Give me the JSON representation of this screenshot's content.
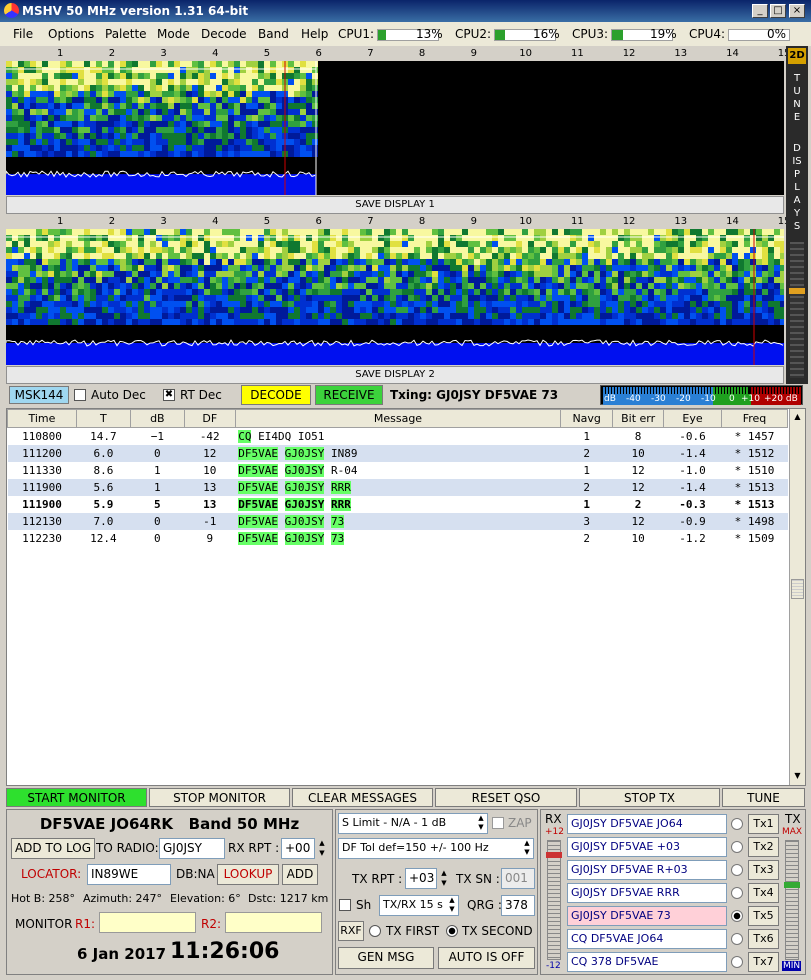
{
  "window": {
    "title": "MSHV 50 MHz version 1.31 64-bit",
    "min": "_",
    "max": "□",
    "close": "×"
  },
  "menu": [
    "File",
    "Options",
    "Palette",
    "Mode",
    "Decode",
    "Band",
    "Help"
  ],
  "cpu": [
    {
      "label": "CPU1:",
      "pct": "13%",
      "fill": 0.13
    },
    {
      "label": "CPU2:",
      "pct": "16%",
      "fill": 0.16
    },
    {
      "label": "CPU3:",
      "pct": "19%",
      "fill": 0.19
    },
    {
      "label": "CPU4:",
      "pct": "0%",
      "fill": 0
    }
  ],
  "ticks": [
    "1",
    "2",
    "3",
    "4",
    "5",
    "6",
    "7",
    "8",
    "9",
    "10",
    "11",
    "12",
    "13",
    "14",
    "15"
  ],
  "save1": "SAVE DISPLAY 1",
  "save2": "SAVE DISPLAY 2",
  "side": {
    "mode2d": "2D",
    "tune": "TUNE",
    "display": "DISPLAYS"
  },
  "status": {
    "mode": "MSK144",
    "autodec": "Auto Dec",
    "rtdec": "RT Dec",
    "decode": "DECODE",
    "receive": "RECEIVE",
    "txing": "Txing: GJ0JSY DF5VAE 73"
  },
  "meter": {
    "scale": [
      "dB",
      "-40",
      "-30",
      "-20",
      "-10",
      "0",
      "+10",
      "+20 dB"
    ]
  },
  "columns": [
    "Time",
    "T",
    "dB",
    "DF",
    "Message",
    "Navg",
    "Bit err",
    "Eye",
    "Freq"
  ],
  "rows": [
    {
      "time": "110800",
      "t": "14.7",
      "db": "−1",
      "df": "-42",
      "msg": [
        "CQ",
        "EI4DQ",
        "IO51"
      ],
      "hlc": [
        1,
        0,
        0
      ],
      "navg": "1",
      "bit": "8",
      "eye": "-0.6",
      "freq": "* 1457",
      "bold": false,
      "bg": "#ffffff"
    },
    {
      "time": "111200",
      "t": "6.0",
      "db": "0",
      "df": "12",
      "msg": [
        "DF5VAE",
        "GJ0JSY",
        "IN89"
      ],
      "hlc": [
        1,
        1,
        0
      ],
      "navg": "2",
      "bit": "10",
      "eye": "-1.4",
      "freq": "* 1512",
      "bold": false,
      "bg": "#d6e0f0"
    },
    {
      "time": "111330",
      "t": "8.6",
      "db": "1",
      "df": "10",
      "msg": [
        "DF5VAE",
        "GJ0JSY",
        "R-04"
      ],
      "hlc": [
        1,
        1,
        0
      ],
      "navg": "1",
      "bit": "12",
      "eye": "-1.0",
      "freq": "* 1510",
      "bold": false,
      "bg": "#ffffff"
    },
    {
      "time": "111900",
      "t": "5.6",
      "db": "1",
      "df": "13",
      "msg": [
        "DF5VAE",
        "GJ0JSY",
        "RRR"
      ],
      "hlc": [
        1,
        1,
        1
      ],
      "navg": "2",
      "bit": "12",
      "eye": "-1.4",
      "freq": "* 1513",
      "bold": false,
      "bg": "#d6e0f0"
    },
    {
      "time": "111900",
      "t": "5.9",
      "db": "5",
      "df": "13",
      "msg": [
        "DF5VAE",
        "GJ0JSY",
        "RRR"
      ],
      "hlc": [
        1,
        1,
        1
      ],
      "navg": "1",
      "bit": "2",
      "eye": "-0.3",
      "freq": "* 1513",
      "bold": true,
      "bg": "#ffffff"
    },
    {
      "time": "112130",
      "t": "7.0",
      "db": "0",
      "df": "-1",
      "msg": [
        "DF5VAE",
        "GJ0JSY",
        "73"
      ],
      "hlc": [
        1,
        1,
        1
      ],
      "navg": "3",
      "bit": "12",
      "eye": "-0.9",
      "freq": "* 1498",
      "bold": false,
      "bg": "#d6e0f0"
    },
    {
      "time": "112230",
      "t": "12.4",
      "db": "0",
      "df": "9",
      "msg": [
        "DF5VAE",
        "GJ0JSY",
        "73"
      ],
      "hlc": [
        1,
        1,
        1
      ],
      "navg": "2",
      "bit": "10",
      "eye": "-1.2",
      "freq": "* 1509",
      "bold": false,
      "bg": "#ffffff"
    }
  ],
  "buttons": {
    "start": "START MONITOR",
    "stop": "STOP MONITOR",
    "clear": "CLEAR MESSAGES",
    "reset": "RESET QSO",
    "stoptx": "STOP TX",
    "tune": "TUNE"
  },
  "station": {
    "title": "DF5VAE JO64RK",
    "band": "Band 50 MHz",
    "addlog": "ADD TO LOG",
    "toradio": "TO RADIO:",
    "callsign": "GJ0JSY",
    "rxrpt": "RX RPT :",
    "rxrptval": "+00",
    "locator": "LOCATOR:",
    "locval": "IN89WE",
    "db": "DB:NA",
    "lookup": "LOOKUP",
    "add": "ADD",
    "hotb": "Hot B: 258°",
    "azimuth": "Azimuth: 247°",
    "elevation": "Elevation: 6°",
    "dstc": "Dstc: 1217 km",
    "monitor": "MONITOR",
    "r1": "R1:",
    "r2": "R2:",
    "date": "6 Jan 2017",
    "time": "11:26:06"
  },
  "mid": {
    "slimit": "S Limit - N/A - 1  dB",
    "zap": "ZAP",
    "dftol": "DF Tol def=150 +/-  100  Hz",
    "txrpt": "TX RPT :",
    "txrptval": "+03",
    "txsn": "TX SN :",
    "txsnval": "001",
    "sh": "Sh",
    "txrx": "TX/RX 15 s",
    "qrg": "QRG :",
    "qrgval": "378",
    "rxf": "RXF",
    "txfirst": "TX FIRST",
    "txsecond": "TX SECOND",
    "genmsg": "GEN MSG",
    "autoisoff": "AUTO IS OFF"
  },
  "tx": {
    "rxlabel": "RX",
    "rxtop": "+12",
    "rxbot": "-12",
    "txlabel": "TX",
    "max": "MAX",
    "min": "MIN",
    "msgs": [
      "GJ0JSY DF5VAE JO64",
      "GJ0JSY DF5VAE +03",
      "GJ0JSY DF5VAE R+03",
      "GJ0JSY DF5VAE RRR",
      "GJ0JSY DF5VAE 73",
      "CQ DF5VAE JO64",
      "CQ 378 DF5VAE"
    ],
    "btns": [
      "Tx1",
      "Tx2",
      "Tx3",
      "Tx4",
      "Tx5",
      "Tx6",
      "Tx7"
    ],
    "active": 4
  }
}
